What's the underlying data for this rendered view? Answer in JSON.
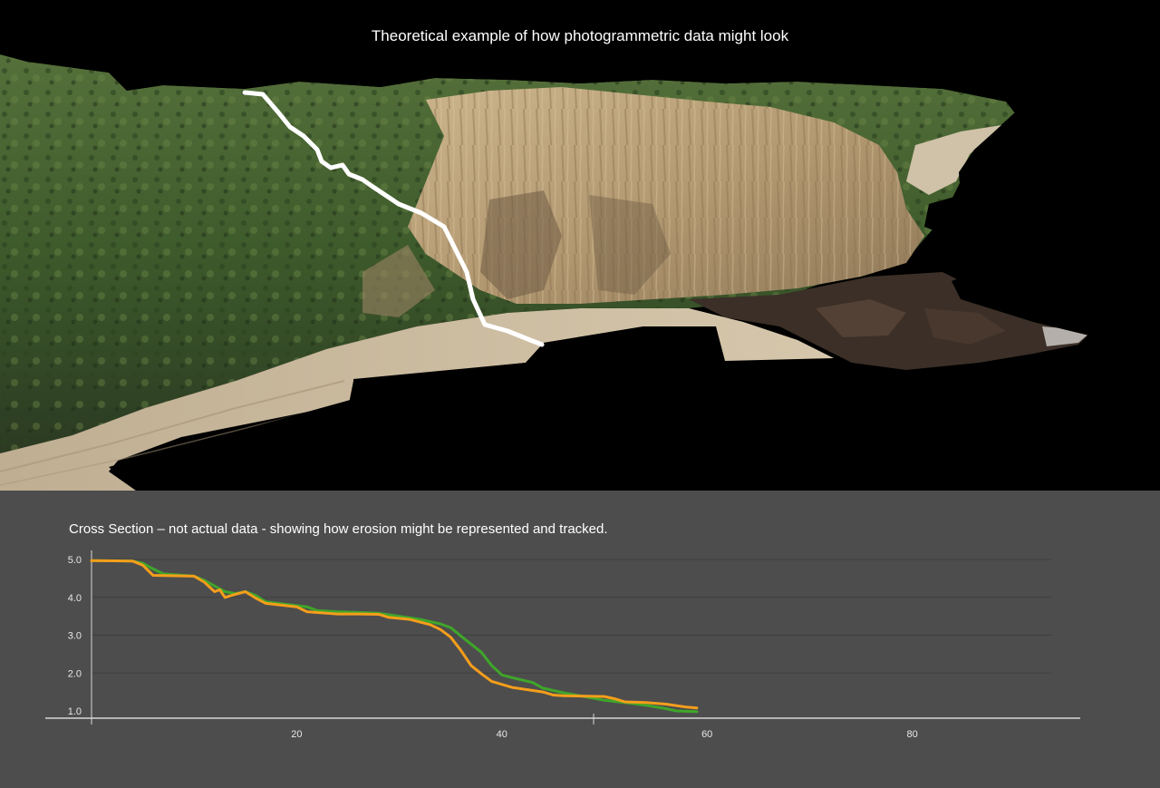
{
  "photo": {
    "title": "Theoretical example of how photogrammetric data might look",
    "colors": {
      "sky": "#000000",
      "vegetation": "#3f5a2c",
      "cliff": "#b9a27a",
      "sand": "#c8b89d",
      "rocks": "#3a2e27",
      "trace_line": "#ffffff"
    }
  },
  "chart_caption": "Cross Section – not actual data - showing how erosion might be represented and tracked.",
  "chart_data": {
    "type": "line",
    "title": "",
    "xlabel": "",
    "ylabel": "",
    "xlim": [
      0,
      96
    ],
    "ylim": [
      1.0,
      5.0
    ],
    "x_ticks": [
      20,
      40,
      60,
      80
    ],
    "y_ticks": [
      "1.0",
      "2.0",
      "3.0",
      "4.0",
      "5.0"
    ],
    "grid": true,
    "legend": "none",
    "colors": {
      "background": "#4d4d4d",
      "grid": "#3e3e3e",
      "axis": "#d8d8d8"
    },
    "series": [
      {
        "color": "#3fa62a",
        "points": [
          [
            0,
            4.97
          ],
          [
            4,
            4.96
          ],
          [
            5,
            4.9
          ],
          [
            6,
            4.75
          ],
          [
            7,
            4.62
          ],
          [
            10,
            4.56
          ],
          [
            11,
            4.45
          ],
          [
            12,
            4.3
          ],
          [
            13,
            4.15
          ],
          [
            14,
            4.1
          ],
          [
            15,
            4.15
          ],
          [
            16,
            4.05
          ],
          [
            17,
            3.88
          ],
          [
            20,
            3.78
          ],
          [
            21,
            3.75
          ],
          [
            22,
            3.65
          ],
          [
            24,
            3.62
          ],
          [
            26,
            3.6
          ],
          [
            28,
            3.58
          ],
          [
            30,
            3.5
          ],
          [
            32,
            3.42
          ],
          [
            34,
            3.3
          ],
          [
            35,
            3.2
          ],
          [
            36,
            2.98
          ],
          [
            38,
            2.55
          ],
          [
            39,
            2.2
          ],
          [
            40,
            1.95
          ],
          [
            41,
            1.88
          ],
          [
            43,
            1.75
          ],
          [
            44,
            1.6
          ],
          [
            46,
            1.48
          ],
          [
            48,
            1.38
          ],
          [
            50,
            1.28
          ],
          [
            52,
            1.22
          ],
          [
            54,
            1.15
          ],
          [
            56,
            1.06
          ],
          [
            57,
            1.0
          ],
          [
            59,
            0.98
          ]
        ]
      },
      {
        "color": "#f59e1b",
        "points": [
          [
            0,
            4.97
          ],
          [
            4,
            4.96
          ],
          [
            5,
            4.85
          ],
          [
            6,
            4.58
          ],
          [
            10,
            4.56
          ],
          [
            11,
            4.4
          ],
          [
            12,
            4.15
          ],
          [
            12.5,
            4.2
          ],
          [
            13,
            4.0
          ],
          [
            14,
            4.08
          ],
          [
            15,
            4.15
          ],
          [
            16,
            3.98
          ],
          [
            17,
            3.84
          ],
          [
            20,
            3.75
          ],
          [
            21,
            3.62
          ],
          [
            24,
            3.56
          ],
          [
            26,
            3.56
          ],
          [
            28,
            3.55
          ],
          [
            29,
            3.47
          ],
          [
            31,
            3.42
          ],
          [
            33,
            3.28
          ],
          [
            34,
            3.15
          ],
          [
            35,
            2.95
          ],
          [
            36,
            2.6
          ],
          [
            37,
            2.2
          ],
          [
            38,
            1.98
          ],
          [
            39,
            1.78
          ],
          [
            41,
            1.62
          ],
          [
            44,
            1.5
          ],
          [
            45,
            1.42
          ],
          [
            46,
            1.4
          ],
          [
            50,
            1.38
          ],
          [
            51,
            1.32
          ],
          [
            52,
            1.24
          ],
          [
            54,
            1.22
          ],
          [
            56,
            1.18
          ],
          [
            58,
            1.1
          ],
          [
            59,
            1.08
          ]
        ]
      }
    ]
  }
}
